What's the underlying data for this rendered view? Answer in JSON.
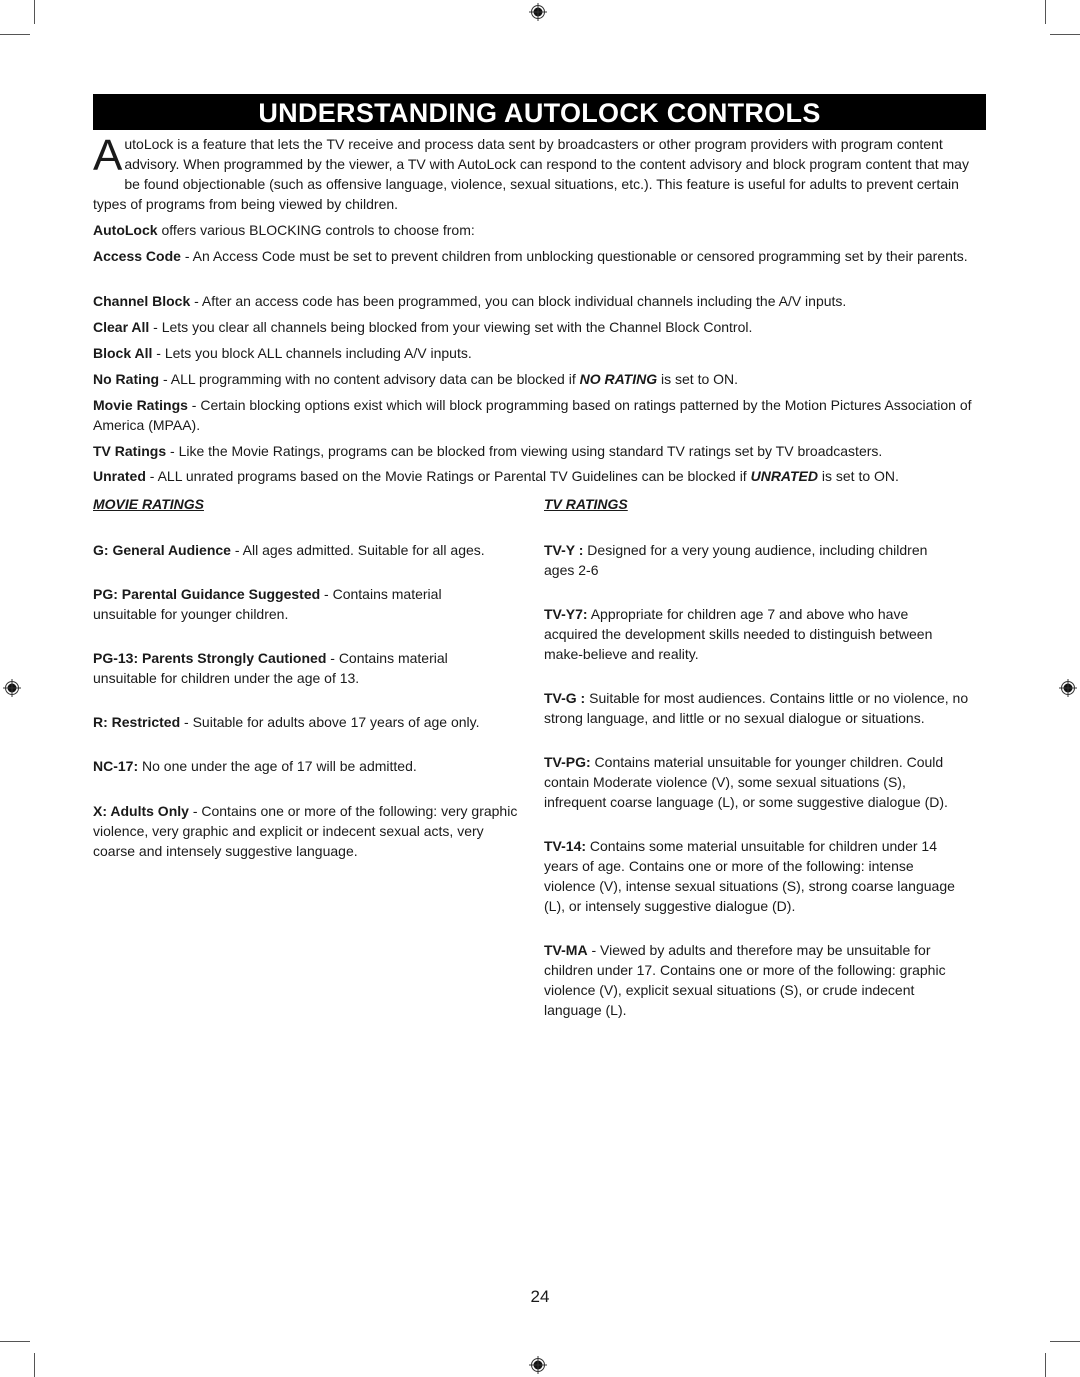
{
  "page": {
    "title": "UNDERSTANDING AUTOLOCK CONTROLS",
    "page_number": "24"
  },
  "intro": {
    "dropcap": "A",
    "text": "utoLock is a feature that lets the TV receive and process data sent by broadcasters or other program providers with program content advisory. When programmed by the viewer, a TV with AutoLock can respond to the content advisory and block program content that may be found objectionable (such as offensive language, violence, sexual situations, etc.). This feature is useful for adults to prevent certain types of programs from being viewed by children."
  },
  "controls_intro": {
    "term": "AutoLock",
    "text": " offers various BLOCKING controls to choose from:"
  },
  "controls": [
    {
      "term": "Access Code",
      "text": " - An Access Code must be set to prevent children from unblocking questionable or censored programming set by their parents."
    },
    {
      "term": "Channel Block",
      "text": " - After an access code has been programmed, you can block individual channels including the A/V inputs."
    },
    {
      "term": "Clear All",
      "text": " - Lets you clear all channels being blocked from your viewing set with the Channel Block Control."
    },
    {
      "term": "Block All",
      "text": " - Lets you block ALL channels including A/V inputs."
    },
    {
      "term": "No Rating",
      "text_before": " -  ALL programming with no content advisory data can be blocked if ",
      "emph": "NO RATING",
      "text_after": " is set to ON."
    },
    {
      "term": "Movie Ratings",
      "text": " - Certain blocking options exist which will block programming based on ratings patterned by the Motion Pictures Association of America (MPAA)."
    },
    {
      "term": "TV Ratings",
      "text": " - Like the Movie Ratings, programs can be blocked from viewing using standard TV ratings set by TV broadcasters."
    },
    {
      "term": "Unrated",
      "text_before": " -  ALL unrated programs based on the Movie Ratings or Parental TV Guidelines can be blocked if ",
      "emph": "UNRATED",
      "text_after": " is set to ON."
    }
  ],
  "movie_ratings": {
    "heading": "MOVIE RATINGS",
    "items": [
      {
        "term": "G: General Audience",
        "text": " - All ages admitted.  Suitable for all ages."
      },
      {
        "term": "PG: Parental Guidance Suggested",
        "text": " - Contains material unsuitable for younger children."
      },
      {
        "term": "PG-13: Parents Strongly Cautioned",
        "text": " - Contains material unsuitable for children under the age of 13."
      },
      {
        "term": "R: Restricted",
        "text": " - Suitable for adults above 17 years of age only."
      },
      {
        "term": "NC-17:",
        "text": " No one under the age of 17 will be admitted."
      },
      {
        "term": "X: Adults Only",
        "text": " - Contains one or more of the following: very graphic violence, very graphic and explicit or indecent sexual acts, very coarse and intensely suggestive language."
      }
    ]
  },
  "tv_ratings": {
    "heading": "TV RATINGS",
    "items": [
      {
        "term": "TV-Y :",
        "text": " Designed for a very young audience, including children ages 2-6"
      },
      {
        "term": "TV-Y7:",
        "text": " Appropriate for children age 7 and above who have acquired the development skills needed to distinguish between make-believe and reality."
      },
      {
        "term": "TV-G :",
        "text": " Suitable for most audiences. Contains little or no violence, no strong language, and little or no sexual dialogue or situations."
      },
      {
        "term": "TV-PG:",
        "text": " Contains material unsuitable for younger children. Could contain Moderate violence (V), some sexual situations (S), infrequent coarse language (L), or some suggestive dialogue (D)."
      },
      {
        "term": "TV-14:",
        "text": " Contains some material unsuitable for children under 14 years of age. Contains one or more of the following: intense violence (V), intense sexual situations (S), strong coarse language (L), or intensely suggestive dialogue (D)."
      },
      {
        "term": "TV-MA",
        "text": " - Viewed by adults and therefore may be unsuitable for children under 17. Contains one or more of the following: graphic violence (V), explicit sexual situations (S), or crude indecent language (L)."
      }
    ]
  },
  "icons": {
    "registration_mark": "registration-mark-icon",
    "crop_mark": "crop-mark"
  }
}
